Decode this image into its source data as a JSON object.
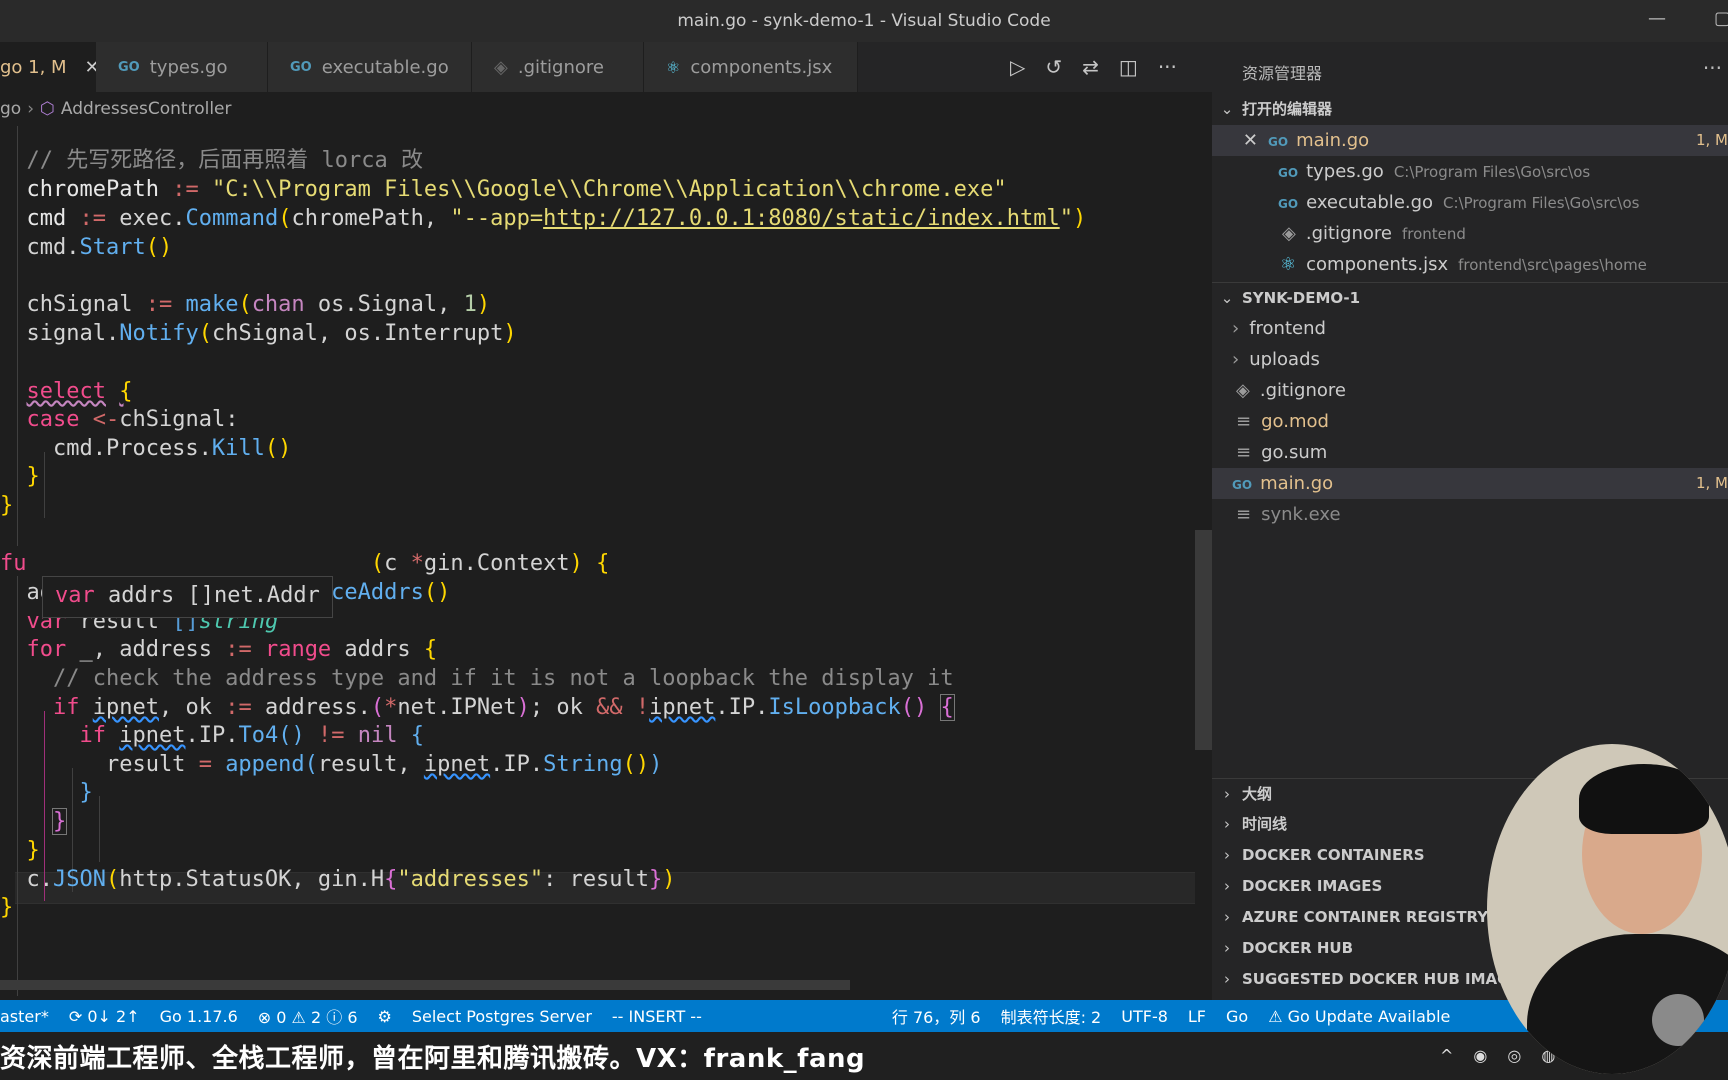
{
  "window": {
    "title": "main.go - synk-demo-1 - Visual Studio Code"
  },
  "tabs": [
    {
      "label": "go 1, M",
      "active": true
    },
    {
      "label": "types.go"
    },
    {
      "label": "executable.go"
    },
    {
      "label": ".gitignore"
    },
    {
      "label": "components.jsx"
    }
  ],
  "breadcrumb": {
    "file": "go",
    "symbol": "AddressesController"
  },
  "hover": {
    "kw": "var",
    "text": " addrs []net.Addr"
  },
  "explorer": {
    "title": "资源管理器",
    "open_editors_header": "打开的编辑器",
    "open_editors": [
      {
        "name": "main.go",
        "desc": "",
        "badge": "1, M"
      },
      {
        "name": "types.go",
        "desc": "C:\\Program Files\\Go\\src\\os"
      },
      {
        "name": "executable.go",
        "desc": "C:\\Program Files\\Go\\src\\os"
      },
      {
        "name": ".gitignore",
        "desc": "frontend"
      },
      {
        "name": "components.jsx",
        "desc": "frontend\\src\\pages\\home"
      }
    ],
    "project_header": "SYNK-DEMO-1",
    "files": [
      {
        "name": "frontend"
      },
      {
        "name": "uploads"
      },
      {
        "name": ".gitignore"
      },
      {
        "name": "go.mod"
      },
      {
        "name": "go.sum"
      },
      {
        "name": "main.go",
        "badge": "1, M"
      },
      {
        "name": "synk.exe"
      }
    ],
    "bottom_sections": [
      "大纲",
      "时间线",
      "DOCKER CONTAINERS",
      "DOCKER IMAGES",
      "AZURE CONTAINER REGISTRY",
      "DOCKER HUB",
      "SUGGESTED DOCKER HUB IMAGES"
    ]
  },
  "status": {
    "branch": "aster*",
    "sync": "0↓ 2↑",
    "go_version": "Go 1.17.6",
    "problems": "⊗ 0 ⚠ 2 ⓘ 6",
    "postgres": "Select Postgres Server",
    "mode": "-- INSERT --",
    "position": "行 76，列 6",
    "tab_size": "制表符长度: 2",
    "encoding": "UTF-8",
    "eol": "LF",
    "language": "Go",
    "update": "⚠ Go Update Available"
  },
  "subtitle": "资深前端工程师、全栈工程师，曾在阿里和腾讯搬砖。VX：frank_fang"
}
